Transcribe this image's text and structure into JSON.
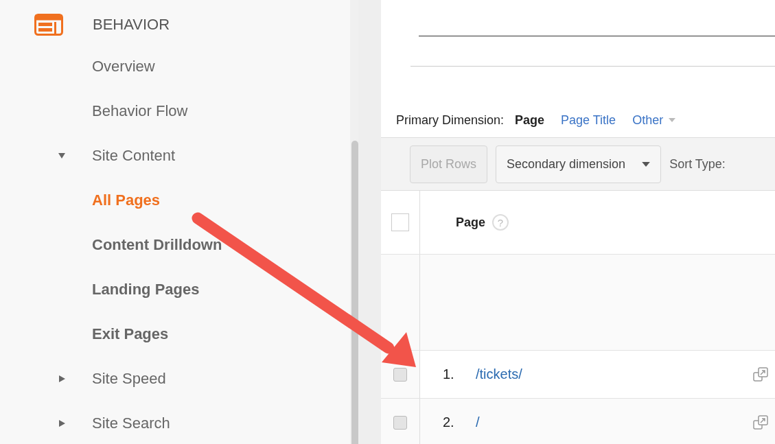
{
  "sidebar": {
    "section": {
      "title": "BEHAVIOR"
    },
    "items": [
      {
        "kind": "link",
        "label": "Overview",
        "selected": false
      },
      {
        "kind": "link",
        "label": "Behavior Flow",
        "selected": false
      },
      {
        "kind": "group",
        "label": "Site Content",
        "expanded": true,
        "children": [
          {
            "label": "All Pages",
            "selected": true
          },
          {
            "label": "Content Drilldown",
            "selected": false
          },
          {
            "label": "Landing Pages",
            "selected": false
          },
          {
            "label": "Exit Pages",
            "selected": false
          }
        ]
      },
      {
        "kind": "group",
        "label": "Site Speed",
        "expanded": false
      },
      {
        "kind": "group",
        "label": "Site Search",
        "expanded": false
      }
    ]
  },
  "primary_dimension": {
    "label": "Primary Dimension:",
    "options": [
      {
        "kind": "option",
        "label": "Page",
        "selected": true
      },
      {
        "kind": "option",
        "label": "Page Title",
        "selected": false
      },
      {
        "kind": "menu",
        "label": "Other",
        "selected": false
      }
    ]
  },
  "toolbar": {
    "plot_rows": {
      "label": "Plot Rows",
      "disabled": true
    },
    "secondary_dimension": {
      "label": "Secondary dimension"
    },
    "sort_type": "Sort Type:"
  },
  "table": {
    "header_checkbox": {
      "checked": false
    },
    "columns": [
      {
        "label": "Page",
        "help": "?"
      }
    ],
    "rows": [
      {
        "index": "1.",
        "page": "/tickets/",
        "checked": false
      },
      {
        "index": "2.",
        "page": "/",
        "checked": false
      }
    ]
  }
}
